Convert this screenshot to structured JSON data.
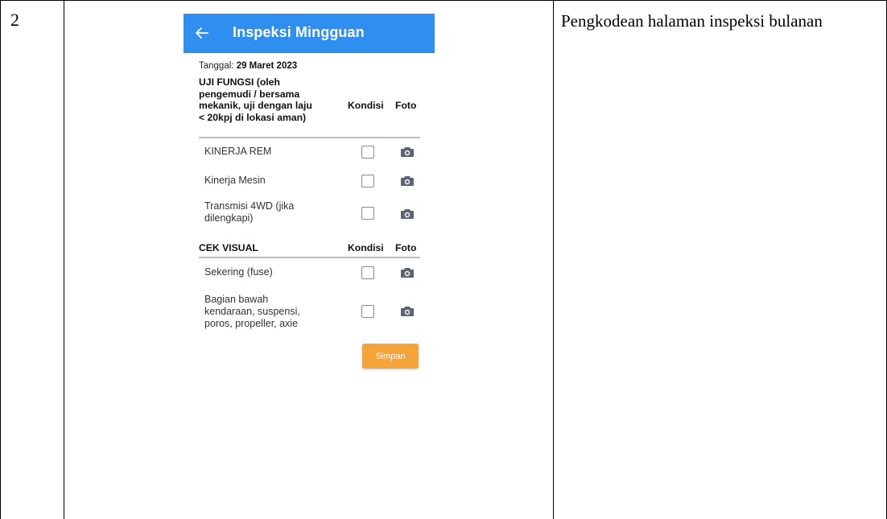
{
  "row_number": "2",
  "description": "Pengkodean halaman inspeksi bulanan",
  "app": {
    "title": "Inspeksi Mingguan",
    "back_icon": "arrow-left-icon",
    "accent_color": "#2f8ff0",
    "button_color": "#f5a43a"
  },
  "date": {
    "label": "Tanggal:",
    "value": "29 Maret 2023"
  },
  "sections": [
    {
      "title_lines": [
        "UJI FUNGSI (oleh",
        "pengemudi / bersama",
        "mekanik, uji dengan laju",
        "< 20kpj di lokasi aman)"
      ],
      "col_kondisi": "Kondisi",
      "col_foto": "Foto",
      "items": [
        {
          "lines": [
            "KINERJA REM"
          ]
        },
        {
          "lines": [
            "Kinerja Mesin"
          ]
        },
        {
          "lines": [
            "Transmisi 4WD (jika",
            "dilengkapi)"
          ]
        }
      ]
    },
    {
      "title_lines": [
        "CEK VISUAL"
      ],
      "col_kondisi": "Kondisi",
      "col_foto": "Foto",
      "items": [
        {
          "lines": [
            "Sekering (fuse)"
          ]
        },
        {
          "lines": [
            "Bagian bawah",
            "kendaraan, suspensi,",
            "poros, propeller, axie"
          ]
        }
      ]
    }
  ],
  "save_button": "Simpan"
}
